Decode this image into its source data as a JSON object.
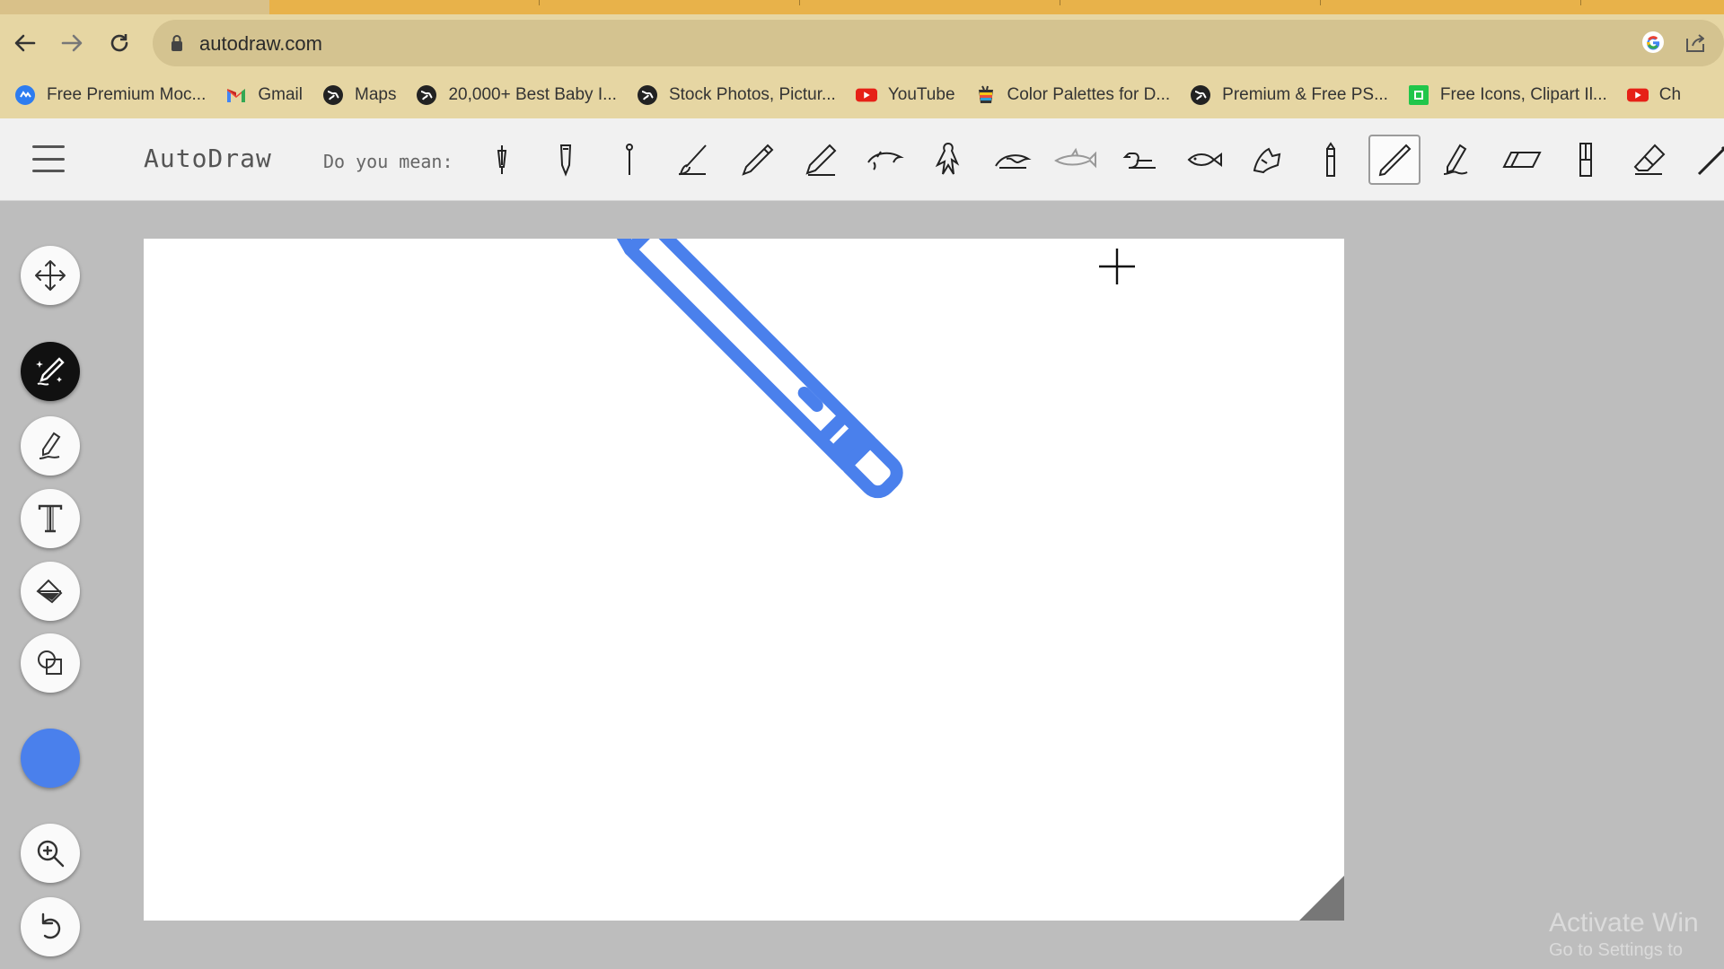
{
  "browser": {
    "url": "autodraw.com",
    "bookmarks": [
      {
        "label": "Free Premium Moc...",
        "icon": "blue-circle-icon"
      },
      {
        "label": "Gmail",
        "icon": "gmail-icon"
      },
      {
        "label": "Maps",
        "icon": "globe-icon"
      },
      {
        "label": "20,000+ Best Baby I...",
        "icon": "globe-icon"
      },
      {
        "label": "Stock Photos, Pictur...",
        "icon": "globe-icon"
      },
      {
        "label": "YouTube",
        "icon": "youtube-icon"
      },
      {
        "label": "Color Palettes for D...",
        "icon": "palette-cup-icon"
      },
      {
        "label": "Premium & Free PS...",
        "icon": "globe-icon"
      },
      {
        "label": "Free Icons, Clipart Il...",
        "icon": "green-square-icon"
      },
      {
        "label": "Ch",
        "icon": "youtube-icon"
      }
    ]
  },
  "app": {
    "title": "AutoDraw",
    "prompt": "Do you mean:",
    "suggestions": [
      "pen-nib-suggestion",
      "fountain-pen-suggestion",
      "thin-pin-suggestion",
      "brush-suggestion",
      "pencil-suggestion",
      "pencil-outline-suggestion",
      "dolphin-suggestion",
      "bird-suggestion",
      "wave-fish-suggestion",
      "shark-suggestion",
      "duck-suggestion",
      "fish-suggestion",
      "cat-sketch-suggestion",
      "crayon-suggestion",
      "pencil-selected-suggestion",
      "pencil-writing-suggestion",
      "eraser-block-suggestion",
      "pen-cap-suggestion",
      "eraser-suggestion",
      "wand-suggestion"
    ],
    "selected_suggestion_index": 14,
    "tools": [
      "move",
      "autodraw",
      "draw",
      "type",
      "fill",
      "shape",
      "color",
      "zoom",
      "undo"
    ],
    "active_tool": "autodraw",
    "current_color": "#4a80ec"
  },
  "watermark": {
    "line1": "Activate Win",
    "line2": "Go to Settings to"
  }
}
